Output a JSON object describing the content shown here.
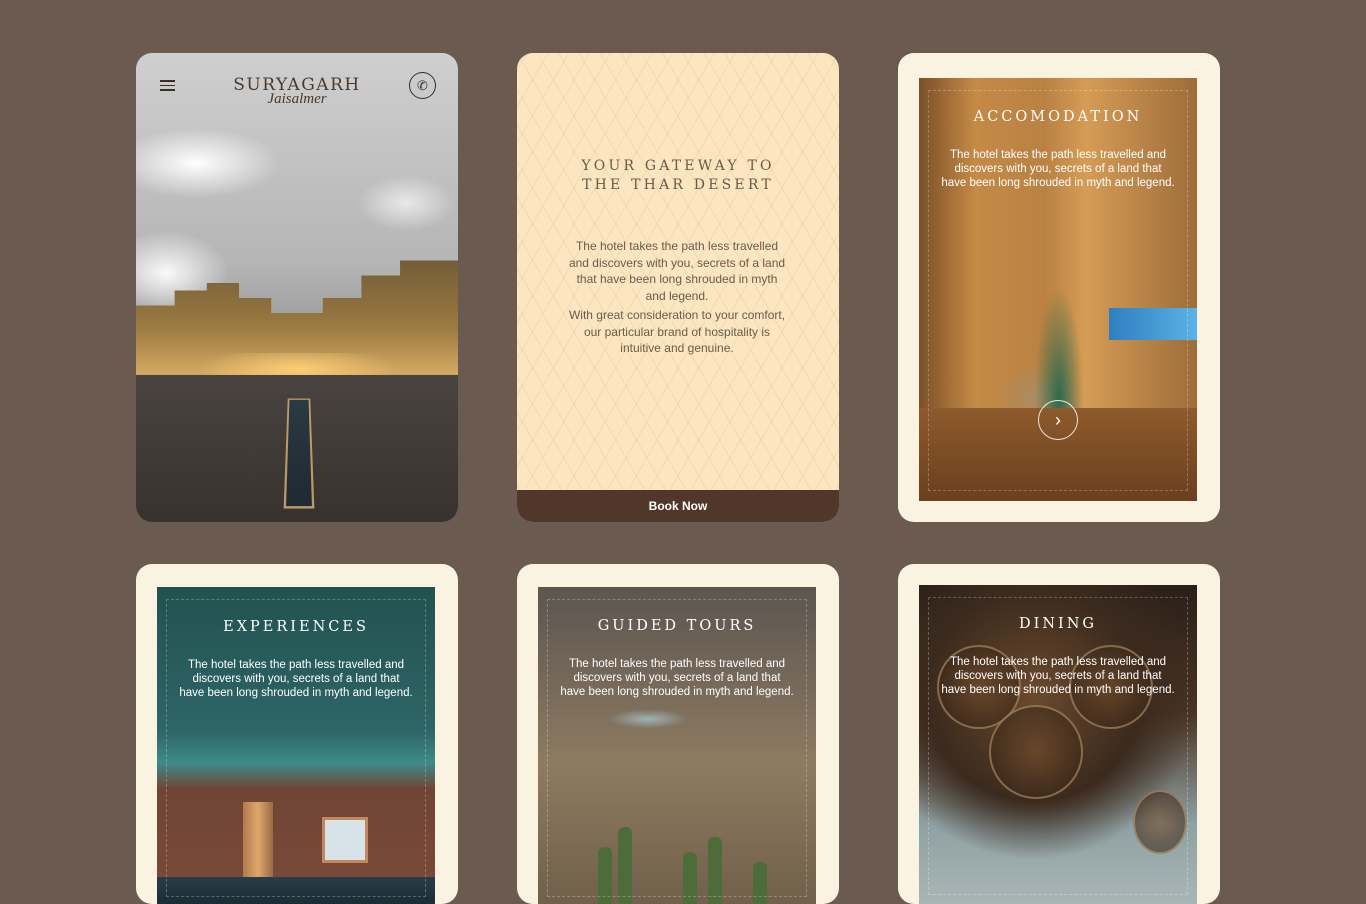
{
  "hero": {
    "brand_name": "SURYAGARH",
    "brand_sub": "Jaisalmer",
    "phone_glyph": "✆"
  },
  "intro": {
    "heading_line1": "YOUR GATEWAY TO",
    "heading_line2": "THE THAR DESERT",
    "paragraph1": "The hotel takes the path less travelled and discovers with you, secrets of a land that have been long shrouded in myth and legend.",
    "paragraph2": "With great consideration to your comfort, our particular brand of hospitality is intuitive and genuine.",
    "book_label": "Book Now"
  },
  "cards": [
    {
      "title": "ACCOMODATION",
      "text": "The hotel takes the path less travelled and discovers with you, secrets of a land that have been long shrouded in myth and legend.",
      "next_glyph": "›"
    },
    {
      "title": "EXPERIENCES",
      "text": "The hotel takes the path less travelled and discovers with you, secrets of a land that have been long shrouded in myth and legend."
    },
    {
      "title": "GUIDED TOURS",
      "text": "The hotel takes the path less travelled and discovers with you, secrets of a land that have been long shrouded in myth and legend."
    },
    {
      "title": "DINING",
      "text": "The hotel takes the path less travelled and discovers with you, secrets of a land that have been long shrouded in myth and legend."
    }
  ],
  "colors": {
    "background": "#6b5a4f",
    "cream": "#fbf3e2",
    "book_bar": "#50372a"
  }
}
